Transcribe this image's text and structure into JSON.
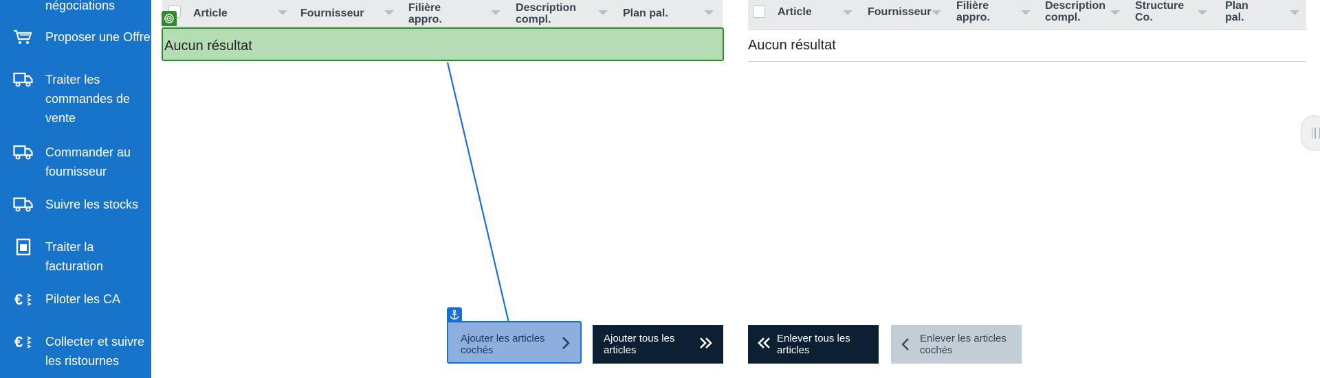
{
  "sidebar": {
    "items": [
      {
        "label": "négociations",
        "icon": "handshake-icon"
      },
      {
        "label": "Proposer une Offre",
        "icon": "cart-icon"
      },
      {
        "label": "Traiter les commandes de vente",
        "icon": "truck-icon"
      },
      {
        "label": "Commander au fournisseur",
        "icon": "truck-icon"
      },
      {
        "label": "Suivre les stocks",
        "icon": "truck-icon"
      },
      {
        "label": "Traiter la facturation",
        "icon": "invoice-icon"
      },
      {
        "label": "Piloter les CA",
        "icon": "euro-icon"
      },
      {
        "label": "Collecter et suivre les ristournes",
        "icon": "euro-icon"
      }
    ]
  },
  "left_table": {
    "columns": [
      "Article",
      "Fournisseur",
      "Filière appro.",
      "Description compl.",
      "Plan pal."
    ],
    "empty_text": "Aucun résultat"
  },
  "right_table": {
    "columns": [
      "Article",
      "Fournisseur",
      "Filière appro.",
      "Description compl.",
      "Structure Co.",
      "Plan pal."
    ],
    "empty_text": "Aucun résultat"
  },
  "buttons": {
    "add_checked": "Ajouter les articles cochés",
    "add_all": "Ajouter tous les articles",
    "remove_all": "Enlever tous les articles",
    "remove_checked": "Enlever les articles cochés"
  },
  "colors": {
    "sidebar_bg": "#1874c8",
    "highlight_green": "#b4ddb4",
    "highlight_border": "#2e8b2e",
    "anchor_blue": "#1a6fd6",
    "dark_button": "#0d1f33",
    "disabled_button": "#c3cdd6"
  }
}
